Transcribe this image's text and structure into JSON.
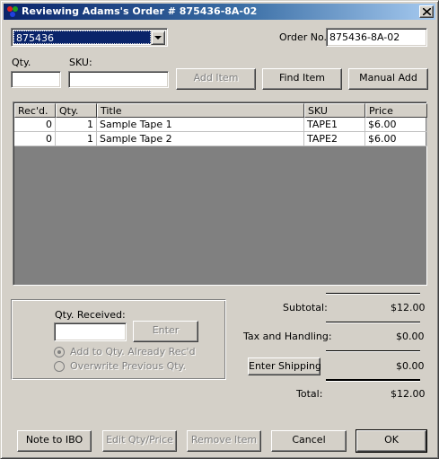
{
  "window": {
    "title": "Reviewing Adams's Order # 875436-8A-02"
  },
  "order": {
    "combo_value": "875436",
    "order_no_label": "Order No.",
    "order_no_value": "875436-8A-02"
  },
  "entry": {
    "qty_label": "Qty.",
    "qty_value": "",
    "sku_label": "SKU:",
    "sku_value": "",
    "add_item_label": "Add Item",
    "find_item_label": "Find Item",
    "manual_add_label": "Manual Add"
  },
  "items_table": {
    "columns": [
      "Rec'd.",
      "Qty.",
      "Title",
      "SKU",
      "Price"
    ],
    "rows": [
      {
        "recd": "0",
        "qty": "1",
        "title": "Sample Tape 1",
        "sku": "TAPE1",
        "price": "$6.00"
      },
      {
        "recd": "0",
        "qty": "1",
        "title": "Sample Tape 2",
        "sku": "TAPE2",
        "price": "$6.00"
      }
    ]
  },
  "receive": {
    "qty_received_label": "Qty. Received:",
    "qty_received_value": "",
    "enter_label": "Enter",
    "radio_add_label": "Add to Qty. Already Rec'd",
    "radio_overwrite_label": "Overwrite Previous Qty.",
    "radio_add_selected": true
  },
  "totals": {
    "subtotal_label": "Subtotal:",
    "subtotal_value": "$12.00",
    "tax_label": "Tax and Handling:",
    "tax_value": "$0.00",
    "shipping_button_label": "Enter Shipping",
    "shipping_value": "$0.00",
    "total_label": "Total:",
    "total_value": "$12.00"
  },
  "footer": {
    "note_label": "Note to IBO",
    "edit_label": "Edit Qty/Price",
    "remove_label": "Remove Item",
    "cancel_label": "Cancel",
    "ok_label": "OK"
  },
  "colors": {
    "title_start": "#0a246a",
    "title_end": "#a6caf0",
    "face": "#d4d0c8",
    "selection": "#0a246a",
    "list_background": "#808080"
  },
  "icons": {
    "app": "app-icon",
    "close": "close-icon",
    "dropdown": "chevron-down-icon",
    "radio": "radio-icon"
  }
}
